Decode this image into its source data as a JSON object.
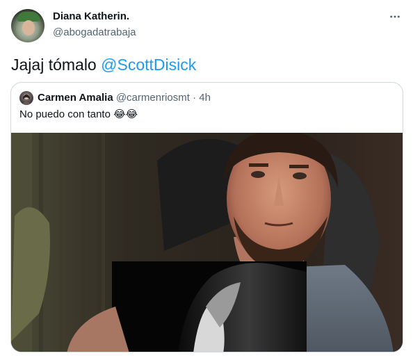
{
  "tweet": {
    "author_name": "Diana Katherin.",
    "author_handle": "@abogadatrabaja",
    "more_icon": "more-horizontal-icon",
    "text_prefix": "Jajaj tómalo ",
    "mention": "@ScottDisick"
  },
  "quoted_tweet": {
    "author_name": "Carmen Amalia",
    "author_handle": "@carmenriosmt",
    "separator": "·",
    "time": "4h",
    "text": "No puedo con tanto 😂😂"
  },
  "colors": {
    "link": "#1d9bf0",
    "secondary_text": "#536471",
    "border": "#cfd9de"
  }
}
